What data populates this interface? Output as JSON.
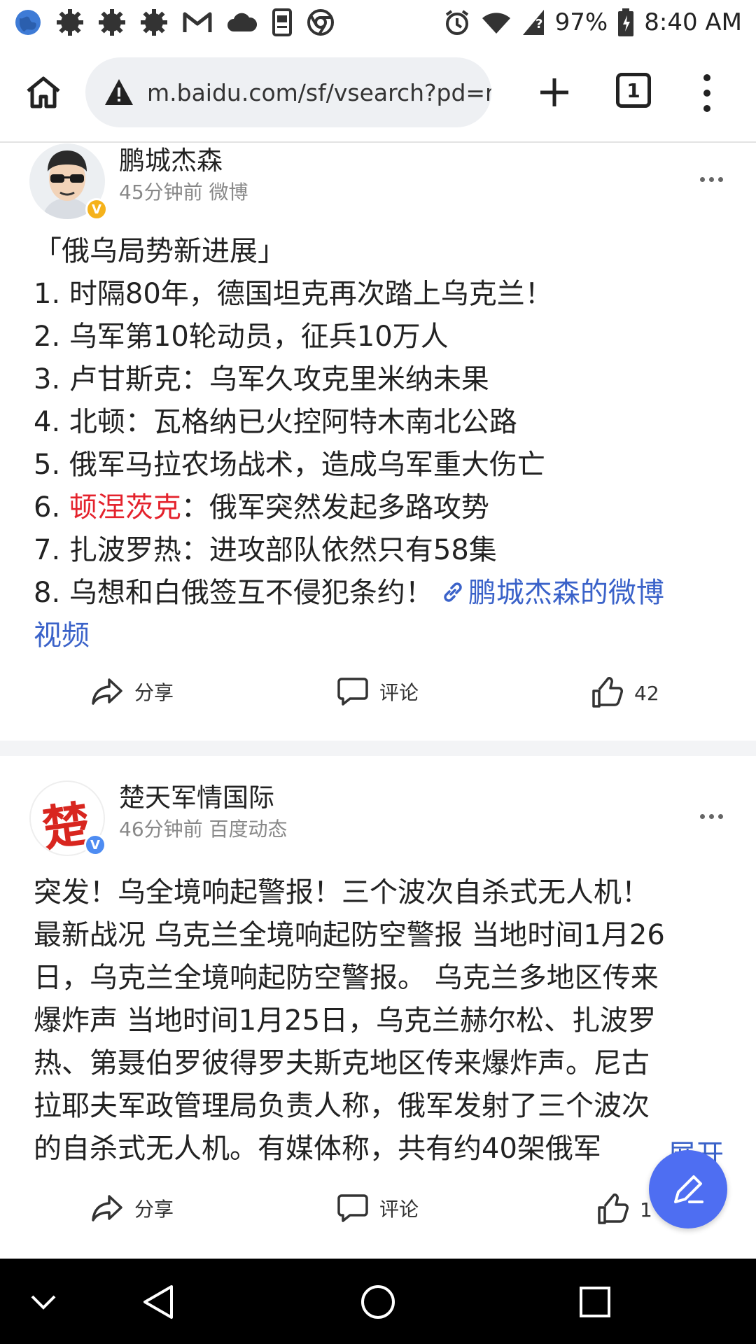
{
  "status_bar": {
    "battery": "97%",
    "time": "8:40 AM",
    "icons_left": [
      "globe-icon",
      "gear-icon",
      "gear-icon",
      "gear-icon",
      "gmail-icon",
      "cloud-icon",
      "reader-icon",
      "chrome-icon"
    ],
    "icons_right": [
      "alarm-icon",
      "wifi-icon",
      "signal-icon",
      "battery-icon"
    ]
  },
  "browser": {
    "url": "m.baidu.com/sf/vsearch?pd=r",
    "tab_count": "1"
  },
  "posts": [
    {
      "author": "鹏城杰森",
      "meta": "45分钟前  微博",
      "lines": [
        "「俄乌局势新进展」",
        "1. 时隔80年，德国坦克再次踏上乌克兰！",
        "2. 乌军第10轮动员，征兵10万人",
        "3. 卢甘斯克：乌军久攻克里米纳未果",
        "4. 北顿：瓦格纳已火控阿特木南北公路",
        "5. 俄军马拉农场战术，造成乌军重大伤亡"
      ],
      "line6_prefix": "6. ",
      "line6_highlight": "顿涅茨克",
      "line6_suffix": "：俄军突然发起多路攻势",
      "line7": "7. 扎波罗热：进攻部队依然只有58集",
      "line8": "8. 乌想和白俄签互不侵犯条约！",
      "link_text": "鹏城杰森的微博",
      "link_text_2": "视频",
      "share": "分享",
      "comment": "评论",
      "likes": "42"
    },
    {
      "author": "楚天军情国际",
      "avatar_char": "楚",
      "meta": "46分钟前  百度动态",
      "lines": [
        "突发！乌全境响起警报！三个波次自杀式无人机！",
        "最新战况 乌克兰全境响起防空警报 当地时间1月26",
        "日，乌克兰全境响起防空警报。 乌克兰多地区传来",
        "爆炸声 当地时间1月25日，乌克兰赫尔松、扎波罗",
        "热、第聂伯罗彼得罗夫斯克地区传来爆炸声。尼古",
        "拉耶夫军政管理局负责人称，俄军发射了三个波次",
        "的自杀式无人机。有媒体称，共有约40架俄军"
      ],
      "expand": "展开",
      "share": "分享",
      "comment": "评论",
      "likes": "1"
    }
  ],
  "colors": {
    "accent": "#4e6ef2",
    "link": "#3a62c9",
    "highlight": "#e4222c",
    "verified_gold": "#f5b21b",
    "verified_blue": "#4e8cf2"
  }
}
